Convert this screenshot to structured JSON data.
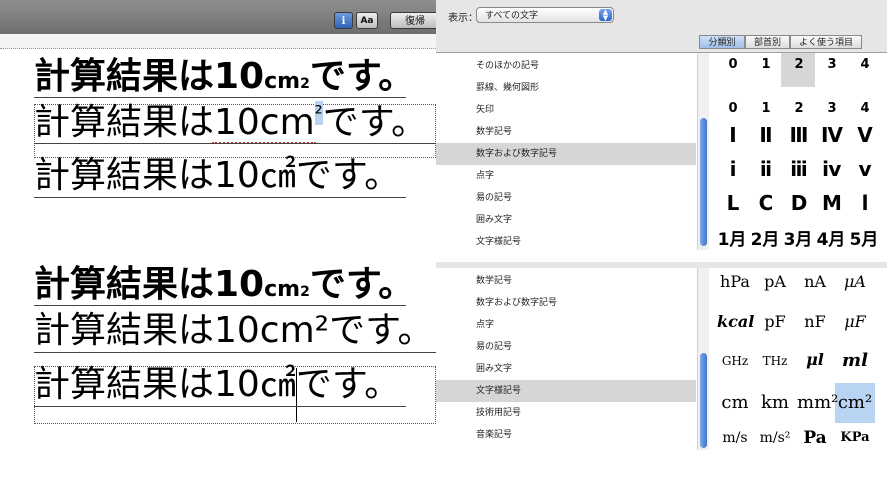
{
  "toolbar": {
    "font_button": "Aa",
    "restore_button": "復帰"
  },
  "editor_top": {
    "line1": {
      "prefix": "計算結果は10",
      "unit": "cm",
      "sub": "2",
      "suffix": "です。"
    },
    "line2": {
      "prefix": "計算結果は10cm",
      "sup": "²",
      "suffix": "です。"
    },
    "line3": {
      "prefix": "計算結果は10",
      "unit": "㎠",
      "suffix": "です。"
    }
  },
  "editor_bottom": {
    "line1": {
      "prefix": "計算結果は10",
      "unit": "cm",
      "sub": "2",
      "suffix": "です。"
    },
    "line2": {
      "text": "計算結果は10cm²です。"
    },
    "line3": {
      "prefix": "計算結果は10",
      "unit": "㎠",
      "suffix": "です。"
    }
  },
  "viewer": {
    "show_label": "表示：",
    "show_value": "すべての文字",
    "tabs": [
      "分類別",
      "部首別",
      "よく使う項目"
    ],
    "active_tab": "分類別",
    "top_categories": [
      "そのほかの記号",
      "罫線、幾何図形",
      "矢印",
      "数学記号",
      "数字および数字記号",
      "点字",
      "易の記号",
      "囲み文字",
      "文字様記号"
    ],
    "top_selected": "数字および数字記号",
    "bottom_categories": [
      "数学記号",
      "数字および数字記号",
      "点字",
      "易の記号",
      "囲み文字",
      "文字様記号",
      "技術用記号",
      "音楽記号"
    ],
    "bottom_selected": "文字様記号",
    "top_grid": [
      [
        "0",
        "1",
        "2",
        "3",
        "4"
      ],
      [
        "0",
        "1",
        "2",
        "3",
        "4"
      ],
      [
        "Ⅰ",
        "Ⅱ",
        "Ⅲ",
        "Ⅳ",
        "Ⅴ"
      ],
      [
        "ⅰ",
        "ⅱ",
        "ⅲ",
        "ⅳ",
        "ⅴ"
      ],
      [
        "Ⅼ",
        "Ⅽ",
        "Ⅾ",
        "Ⅿ",
        "ⅼ"
      ],
      [
        "1月",
        "2月",
        "3月",
        "4月",
        "5月"
      ]
    ],
    "bottom_grid": [
      [
        "hPa",
        "pA",
        "nA",
        "μA"
      ],
      [
        "kcal",
        "pF",
        "nF",
        "μF"
      ],
      [
        "GHz",
        "THz",
        "μl",
        "ml"
      ],
      [
        "cm",
        "km",
        "mm²",
        "cm²"
      ],
      [
        "m/s",
        "m/s²",
        "Pa",
        "KPa"
      ]
    ]
  }
}
